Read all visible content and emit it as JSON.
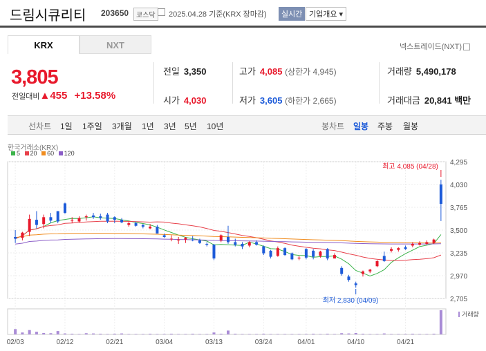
{
  "header": {
    "name": "드림시큐리티",
    "code": "203650",
    "market": "코스닥",
    "date": "2025.04.28 기준(KRX 장마감)",
    "realtime": "실시간",
    "company": "기업개요 ▾"
  },
  "tabs": {
    "krx": "KRX",
    "nxt": "NXT",
    "nxt_rate": "넥스트레이드(NXT)"
  },
  "quote": {
    "price": "3,805",
    "change_label": "전일대비",
    "change": "▲455",
    "change_pct": "+13.58%",
    "prev_label": "전일",
    "prev": "3,350",
    "open_label": "시가",
    "open": "4,030",
    "high_label": "고가",
    "high": "4,085",
    "upper_limit": "(상한가 4,945)",
    "low_label": "저가",
    "low": "3,605",
    "lower_limit": "(하한가 2,665)",
    "volume_label": "거래량",
    "volume": "5,490,178",
    "amount_label": "거래대금",
    "amount": "20,841 백만"
  },
  "toolbar": {
    "line_label": "선차트",
    "periods": [
      "1일",
      "1주일",
      "3개월",
      "1년",
      "3년",
      "5년",
      "10년"
    ],
    "candle_label": "봉차트",
    "candles": [
      "일봉",
      "주봉",
      "월봉"
    ]
  },
  "chart": {
    "source": "한국거래소(KRX)",
    "ma": [
      {
        "label": "5",
        "color": "#3cb34a"
      },
      {
        "label": "20",
        "color": "#e8404a"
      },
      {
        "label": "60",
        "color": "#f08c1e"
      },
      {
        "label": "120",
        "color": "#8a5cc7"
      }
    ],
    "max_label": "최고 4,085 (04/28)",
    "min_label": "최저 2,830 (04/09)",
    "volume_label": "거래량",
    "up_color": "#e8192c",
    "down_color": "#1d5bd9"
  },
  "chart_data": {
    "type": "candlestick",
    "ylim": [
      2705,
      4295
    ],
    "yticks": [
      "4,295",
      "4,030",
      "3,765",
      "3,500",
      "3,235",
      "2,970",
      "2,705"
    ],
    "xticks": [
      "02/03",
      "02/12",
      "02/21",
      "03/04",
      "03/13",
      "03/24",
      "04/01",
      "04/10",
      "04/21"
    ],
    "xtick_index": [
      0,
      7,
      14,
      21,
      28,
      35,
      41,
      48,
      55
    ],
    "candles": [
      [
        3420,
        3500,
        3350,
        3400
      ],
      [
        3410,
        3480,
        3380,
        3470
      ],
      [
        3480,
        3680,
        3430,
        3630
      ],
      [
        3620,
        3720,
        3520,
        3560
      ],
      [
        3570,
        3680,
        3520,
        3650
      ],
      [
        3650,
        3700,
        3580,
        3610
      ],
      [
        3720,
        3720,
        3580,
        3600
      ],
      [
        3810,
        3820,
        3690,
        3700
      ],
      [
        3610,
        3650,
        3580,
        3620
      ],
      [
        3600,
        3660,
        3590,
        3640
      ],
      [
        3650,
        3680,
        3610,
        3660
      ],
      [
        3670,
        3700,
        3630,
        3650
      ],
      [
        3660,
        3690,
        3620,
        3640
      ],
      [
        3680,
        3700,
        3580,
        3600
      ],
      [
        3650,
        3660,
        3580,
        3620
      ],
      [
        3620,
        3640,
        3580,
        3590
      ],
      [
        3560,
        3600,
        3540,
        3580
      ],
      [
        3580,
        3600,
        3540,
        3550
      ],
      [
        3560,
        3570,
        3520,
        3540
      ],
      [
        3520,
        3570,
        3510,
        3540
      ],
      [
        3540,
        3560,
        3460,
        3460
      ],
      [
        3440,
        3460,
        3410,
        3420
      ],
      [
        3400,
        3440,
        3370,
        3400
      ],
      [
        3380,
        3420,
        3340,
        3390
      ],
      [
        3390,
        3420,
        3350,
        3410
      ],
      [
        3390,
        3430,
        3370,
        3380
      ],
      [
        3380,
        3400,
        3340,
        3350
      ],
      [
        3340,
        3360,
        3310,
        3330
      ],
      [
        3330,
        3340,
        3150,
        3170
      ],
      [
        3380,
        3450,
        3360,
        3440
      ],
      [
        3420,
        3550,
        3340,
        3360
      ],
      [
        3360,
        3400,
        3310,
        3330
      ],
      [
        3340,
        3360,
        3280,
        3310
      ],
      [
        3320,
        3370,
        3300,
        3360
      ],
      [
        3360,
        3380,
        3320,
        3330
      ],
      [
        3310,
        3320,
        3210,
        3230
      ],
      [
        3260,
        3270,
        3170,
        3190
      ],
      [
        3200,
        3310,
        3190,
        3290
      ],
      [
        3290,
        3300,
        3200,
        3210
      ],
      [
        3230,
        3240,
        3150,
        3160
      ],
      [
        3170,
        3200,
        3150,
        3180
      ],
      [
        3280,
        3290,
        3160,
        3180
      ],
      [
        3260,
        3280,
        3160,
        3190
      ],
      [
        3200,
        3260,
        3180,
        3250
      ],
      [
        3280,
        3290,
        3150,
        3170
      ],
      [
        3170,
        3230,
        3170,
        3210
      ],
      [
        3060,
        3080,
        2970,
        2990
      ],
      [
        2960,
        2980,
        2900,
        2920
      ],
      [
        2880,
        2900,
        2830,
        2860
      ],
      [
        2990,
        3030,
        2960,
        3020
      ],
      [
        3020,
        3050,
        3000,
        3040
      ],
      [
        3080,
        3150,
        3070,
        3140
      ],
      [
        3200,
        3250,
        3130,
        3140
      ],
      [
        3260,
        3300,
        3240,
        3280
      ],
      [
        3270,
        3300,
        3250,
        3290
      ],
      [
        3300,
        3320,
        3270,
        3280
      ],
      [
        3320,
        3360,
        3300,
        3340
      ],
      [
        3330,
        3370,
        3320,
        3350
      ],
      [
        3340,
        3380,
        3330,
        3360
      ],
      [
        3350,
        3400,
        3340,
        3390
      ],
      [
        4030,
        4085,
        3605,
        3805
      ]
    ],
    "volume": [
      22,
      8,
      18,
      11,
      6,
      5,
      14,
      4,
      3,
      2,
      5,
      4,
      3,
      2,
      3,
      4,
      2,
      2,
      2,
      3,
      2,
      2,
      3,
      2,
      2,
      3,
      2,
      2,
      8,
      3,
      16,
      3,
      2,
      2,
      2,
      3,
      2,
      2,
      2,
      2,
      2,
      2,
      3,
      2,
      3,
      2,
      5,
      4,
      6,
      3,
      2,
      2,
      4,
      2,
      2,
      2,
      3,
      2,
      2,
      3,
      100
    ]
  }
}
